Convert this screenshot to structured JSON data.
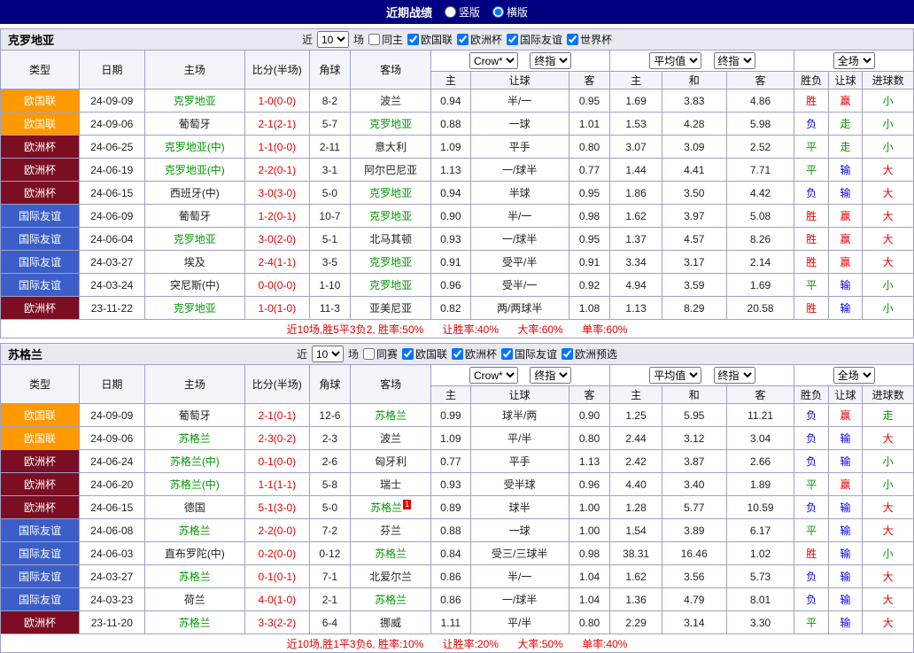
{
  "colors": {
    "topbar_bg": "#000080",
    "league_nations_bg": "#FF9900",
    "euro_bg": "#7B0E22",
    "friendly_bg": "#3C5EC8",
    "win_text": "#E60000",
    "loss_text": "#0000E6",
    "draw_text": "#009900",
    "score_text": "#E60000",
    "focus_team_text": "#009900",
    "summary_text": "#E60000",
    "border": "#A0A0C8",
    "section_bar_bg": "#E9E9F1",
    "header_bg": "#F3F3FA"
  },
  "topbar": {
    "title": "近期战绩",
    "vertical_label": "竖版",
    "horizontal_label": "横版"
  },
  "columns": {
    "type": "类型",
    "date": "日期",
    "home": "主场",
    "score": "比分(半场)",
    "corner": "角球",
    "away": "客场",
    "odds_home": "主",
    "odds_handicap": "让球",
    "odds_away": "客",
    "avg_home": "主",
    "avg_draw": "和",
    "avg_away": "客",
    "result": "胜负",
    "handicap_result": "让球",
    "goals": "进球数"
  },
  "selects": {
    "odds_provider": "Crow*",
    "odds_final": "终指",
    "avg": "平均值",
    "avg_final": "终指",
    "scope": "全场"
  },
  "sections": [
    {
      "team": "克罗地亚",
      "filter": {
        "near": "近",
        "count": "10",
        "games": "场",
        "same": "同主",
        "competitions": [
          "欧国联",
          "欧洲杯",
          "国际友谊",
          "世界杯"
        ]
      },
      "rows": [
        {
          "type": "欧国联",
          "date": "24-09-09",
          "home": "克罗地亚",
          "home_focus": true,
          "score": "1-0(0-0)",
          "corner": "8-2",
          "away": "波兰",
          "away_focus": false,
          "odds_home": "0.94",
          "handicap": "半/一",
          "odds_away": "0.95",
          "avg_home": "1.69",
          "avg_draw": "3.83",
          "avg_away": "4.86",
          "result": "胜",
          "handicap_result": "赢",
          "goals": "小"
        },
        {
          "type": "欧国联",
          "date": "24-09-06",
          "home": "葡萄牙",
          "home_focus": false,
          "score": "2-1(2-1)",
          "corner": "5-7",
          "away": "克罗地亚",
          "away_focus": true,
          "odds_home": "0.88",
          "handicap": "一球",
          "odds_away": "1.01",
          "avg_home": "1.53",
          "avg_draw": "4.28",
          "avg_away": "5.98",
          "result": "负",
          "handicap_result": "走",
          "goals": "小"
        },
        {
          "type": "欧洲杯",
          "date": "24-06-25",
          "home": "克罗地亚(中)",
          "home_focus": true,
          "score": "1-1(0-0)",
          "corner": "2-11",
          "away": "意大利",
          "away_focus": false,
          "odds_home": "1.09",
          "handicap": "平手",
          "odds_away": "0.80",
          "avg_home": "3.07",
          "avg_draw": "3.09",
          "avg_away": "2.52",
          "result": "平",
          "handicap_result": "走",
          "goals": "小"
        },
        {
          "type": "欧洲杯",
          "date": "24-06-19",
          "home": "克罗地亚(中)",
          "home_focus": true,
          "score": "2-2(0-1)",
          "corner": "3-1",
          "away": "阿尔巴尼亚",
          "away_focus": false,
          "odds_home": "1.13",
          "handicap": "一/球半",
          "odds_away": "0.77",
          "avg_home": "1.44",
          "avg_draw": "4.41",
          "avg_away": "7.71",
          "result": "平",
          "handicap_result": "输",
          "goals": "大"
        },
        {
          "type": "欧洲杯",
          "date": "24-06-15",
          "home": "西班牙(中)",
          "home_focus": false,
          "score": "3-0(3-0)",
          "corner": "5-0",
          "away": "克罗地亚",
          "away_focus": true,
          "odds_home": "0.94",
          "handicap": "半球",
          "odds_away": "0.95",
          "avg_home": "1.86",
          "avg_draw": "3.50",
          "avg_away": "4.42",
          "result": "负",
          "handicap_result": "输",
          "goals": "大"
        },
        {
          "type": "国际友谊",
          "date": "24-06-09",
          "home": "葡萄牙",
          "home_focus": false,
          "score": "1-2(0-1)",
          "corner": "10-7",
          "away": "克罗地亚",
          "away_focus": true,
          "odds_home": "0.90",
          "handicap": "半/一",
          "odds_away": "0.98",
          "avg_home": "1.62",
          "avg_draw": "3.97",
          "avg_away": "5.08",
          "result": "胜",
          "handicap_result": "赢",
          "goals": "大"
        },
        {
          "type": "国际友谊",
          "date": "24-06-04",
          "home": "克罗地亚",
          "home_focus": true,
          "score": "3-0(2-0)",
          "corner": "5-1",
          "away": "北马其顿",
          "away_focus": false,
          "odds_home": "0.93",
          "handicap": "一/球半",
          "odds_away": "0.95",
          "avg_home": "1.37",
          "avg_draw": "4.57",
          "avg_away": "8.26",
          "result": "胜",
          "handicap_result": "赢",
          "goals": "大"
        },
        {
          "type": "国际友谊",
          "date": "24-03-27",
          "home": "埃及",
          "home_focus": false,
          "score": "2-4(1-1)",
          "corner": "3-5",
          "away": "克罗地亚",
          "away_focus": true,
          "odds_home": "0.91",
          "handicap": "受平/半",
          "odds_away": "0.91",
          "avg_home": "3.34",
          "avg_draw": "3.17",
          "avg_away": "2.14",
          "result": "胜",
          "handicap_result": "赢",
          "goals": "大"
        },
        {
          "type": "国际友谊",
          "date": "24-03-24",
          "home": "突尼斯(中)",
          "home_focus": false,
          "score": "0-0(0-0)",
          "corner": "1-10",
          "away": "克罗地亚",
          "away_focus": true,
          "odds_home": "0.96",
          "handicap": "受半/一",
          "odds_away": "0.92",
          "avg_home": "4.94",
          "avg_draw": "3.59",
          "avg_away": "1.69",
          "result": "平",
          "handicap_result": "输",
          "goals": "小"
        },
        {
          "type": "欧洲杯",
          "date": "23-11-22",
          "home": "克罗地亚",
          "home_focus": true,
          "score": "1-0(1-0)",
          "corner": "11-3",
          "away": "亚美尼亚",
          "away_focus": false,
          "odds_home": "0.82",
          "handicap": "两/两球半",
          "odds_away": "1.08",
          "avg_home": "1.13",
          "avg_draw": "8.29",
          "avg_away": "20.58",
          "result": "胜",
          "handicap_result": "输",
          "goals": "小"
        }
      ],
      "summary_parts": [
        "近10场,胜5平3负2, 胜率:50%",
        "让胜率:40%",
        "大率:60%",
        "单率:60%"
      ]
    },
    {
      "team": "苏格兰",
      "filter": {
        "near": "近",
        "count": "10",
        "games": "场",
        "same": "同赛",
        "competitions": [
          "欧国联",
          "欧洲杯",
          "国际友谊",
          "欧洲预选"
        ]
      },
      "rows": [
        {
          "type": "欧国联",
          "date": "24-09-09",
          "home": "葡萄牙",
          "home_focus": false,
          "score": "2-1(0-1)",
          "corner": "12-6",
          "away": "苏格兰",
          "away_focus": true,
          "odds_home": "0.99",
          "handicap": "球半/两",
          "odds_away": "0.90",
          "avg_home": "1.25",
          "avg_draw": "5.95",
          "avg_away": "11.21",
          "result": "负",
          "handicap_result": "赢",
          "goals": "走"
        },
        {
          "type": "欧国联",
          "date": "24-09-06",
          "home": "苏格兰",
          "home_focus": true,
          "score": "2-3(0-2)",
          "corner": "2-3",
          "away": "波兰",
          "away_focus": false,
          "odds_home": "1.09",
          "handicap": "平/半",
          "odds_away": "0.80",
          "avg_home": "2.44",
          "avg_draw": "3.12",
          "avg_away": "3.04",
          "result": "负",
          "handicap_result": "输",
          "goals": "大"
        },
        {
          "type": "欧洲杯",
          "date": "24-06-24",
          "home": "苏格兰(中)",
          "home_focus": true,
          "score": "0-1(0-0)",
          "corner": "2-6",
          "away": "匈牙利",
          "away_focus": false,
          "odds_home": "0.77",
          "handicap": "平手",
          "odds_away": "1.13",
          "avg_home": "2.42",
          "avg_draw": "3.87",
          "avg_away": "2.66",
          "result": "负",
          "handicap_result": "输",
          "goals": "小"
        },
        {
          "type": "欧洲杯",
          "date": "24-06-20",
          "home": "苏格兰(中)",
          "home_focus": true,
          "score": "1-1(1-1)",
          "corner": "5-8",
          "away": "瑞士",
          "away_focus": false,
          "odds_home": "0.93",
          "handicap": "受半球",
          "odds_away": "0.96",
          "avg_home": "4.40",
          "avg_draw": "3.40",
          "avg_away": "1.89",
          "result": "平",
          "handicap_result": "赢",
          "goals": "小"
        },
        {
          "type": "欧洲杯",
          "date": "24-06-15",
          "home": "德国",
          "home_focus": false,
          "score": "5-1(3-0)",
          "corner": "5-0",
          "away": "苏格兰",
          "away_focus": true,
          "away_badge": "1",
          "odds_home": "0.89",
          "handicap": "球半",
          "odds_away": "1.00",
          "avg_home": "1.28",
          "avg_draw": "5.77",
          "avg_away": "10.59",
          "result": "负",
          "handicap_result": "输",
          "goals": "大"
        },
        {
          "type": "国际友谊",
          "date": "24-06-08",
          "home": "苏格兰",
          "home_focus": true,
          "score": "2-2(0-0)",
          "corner": "7-2",
          "away": "芬兰",
          "away_focus": false,
          "odds_home": "0.88",
          "handicap": "一球",
          "odds_away": "1.00",
          "avg_home": "1.54",
          "avg_draw": "3.89",
          "avg_away": "6.17",
          "result": "平",
          "handicap_result": "输",
          "goals": "大"
        },
        {
          "type": "国际友谊",
          "date": "24-06-03",
          "home": "直布罗陀(中)",
          "home_focus": false,
          "score": "0-2(0-0)",
          "corner": "0-12",
          "away": "苏格兰",
          "away_focus": true,
          "odds_home": "0.84",
          "handicap": "受三/三球半",
          "odds_away": "0.98",
          "avg_home": "38.31",
          "avg_draw": "16.46",
          "avg_away": "1.02",
          "result": "胜",
          "handicap_result": "输",
          "goals": "小"
        },
        {
          "type": "国际友谊",
          "date": "24-03-27",
          "home": "苏格兰",
          "home_focus": true,
          "score": "0-1(0-1)",
          "corner": "7-1",
          "away": "北爱尔兰",
          "away_focus": false,
          "odds_home": "0.86",
          "handicap": "半/一",
          "odds_away": "1.04",
          "avg_home": "1.62",
          "avg_draw": "3.56",
          "avg_away": "5.73",
          "result": "负",
          "handicap_result": "输",
          "goals": "大"
        },
        {
          "type": "国际友谊",
          "date": "24-03-23",
          "home": "荷兰",
          "home_focus": false,
          "score": "4-0(1-0)",
          "corner": "2-1",
          "away": "苏格兰",
          "away_focus": true,
          "odds_home": "0.86",
          "handicap": "一/球半",
          "odds_away": "1.04",
          "avg_home": "1.36",
          "avg_draw": "4.79",
          "avg_away": "8.01",
          "result": "负",
          "handicap_result": "输",
          "goals": "大"
        },
        {
          "type": "欧洲杯",
          "date": "23-11-20",
          "home": "苏格兰",
          "home_focus": true,
          "score": "3-3(2-2)",
          "corner": "6-4",
          "away": "挪威",
          "away_focus": false,
          "odds_home": "1.11",
          "handicap": "平/半",
          "odds_away": "0.80",
          "avg_home": "2.29",
          "avg_draw": "3.14",
          "avg_away": "3.30",
          "result": "平",
          "handicap_result": "输",
          "goals": "大"
        }
      ],
      "summary_parts": [
        "近10场,胜1平3负6, 胜率:10%",
        "让胜率:20%",
        "大率:50%",
        "单率:40%"
      ]
    }
  ]
}
